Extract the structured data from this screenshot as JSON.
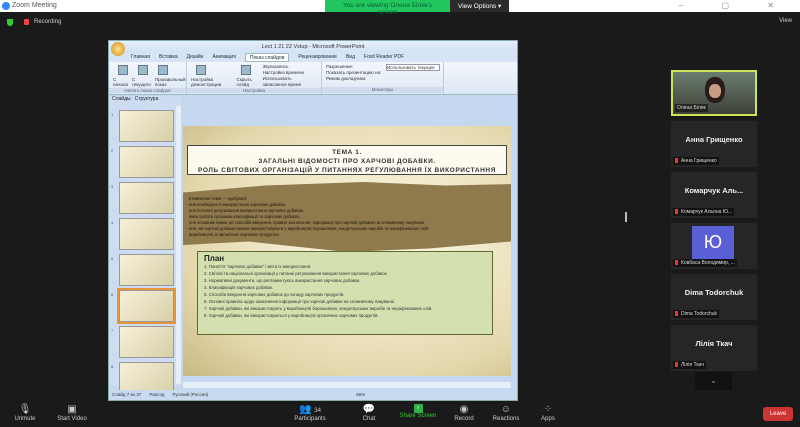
{
  "window": {
    "title": "Zoom Meeting",
    "banner": "You are viewing Олена Біляк's screen",
    "view_options": "View Options ▾",
    "controls": "– ▢ ✕"
  },
  "topbar": {
    "recording": "Recording",
    "view": "View"
  },
  "ppt": {
    "title": "Lect 1 21 22 Vstup - Microsoft PowerPoint",
    "tabs": [
      "Главная",
      "Вставка",
      "Дизайн",
      "Анимация",
      "Показ слайдов",
      "Рецензирование",
      "Вид",
      "Foxit Reader PDF"
    ],
    "groups": [
      {
        "label": "Начать показ слайдов",
        "buttons": [
          "С начала",
          "С текущего слайда",
          "Произвольный показ"
        ]
      },
      {
        "label": "Настройка",
        "buttons": [
          "Настройка демонстрации",
          "Скрыть слайд",
          "Звукозапись",
          "Настройка времени",
          "Использовать записанное время"
        ]
      },
      {
        "label": "Мониторы",
        "buttons": [
          "Разрешение:",
          "Показать презентацию на:",
          "Режим докладчика",
          "Использовать текущее"
        ]
      }
    ],
    "side_tabs": [
      "Слайды",
      "Структура"
    ],
    "slide_numbers": [
      "1",
      "2",
      "3",
      "4",
      "5",
      "6",
      "7",
      "8"
    ],
    "status": [
      "Слайд 7 из 37",
      "Рапсод",
      "Русский (Россия)",
      "55%"
    ]
  },
  "slide": {
    "title_lines": [
      "ТЕМА 1.",
      "ЗАГАЛЬНІ ВІДОМОСТІ ПРО ХАРЧОВІ ДОБАВКИ.",
      "РОЛЬ СВІТОВИХ ОРГАНІЗАЦІЙ У ПИТАННЯХ РЕГУЛЮВАННЯ ЇХ ВИКОРИСТАННЯ"
    ],
    "band_lines": [
      "в вивчення теми — здобувачі:",
      "ння необхідності використання харчових добавок,",
      "ння питання регулювання використання харчових добавок,",
      "ямок роботи органами класифікації та харчових добавок,",
      "ння основних вимог до способів введення, правил зазначення, інформації про харчові добавки на споживчому пакуванні,",
      "ння, які харчові добавки можна використовувати у виробництві борошняних, кондитерських виробів та нерафінованих олій",
      "виробництві, в органічних харчових продуктах"
    ],
    "plan_title": "План",
    "plan_items": [
      "1. Поняття \"харчової добавки\" і мета їх використання.",
      "2. Світові та національні організації у питанні регулювання використання харчових добавок.",
      "3. Нормативні документи, що регламентують використання харчових добавок.",
      "4. Класифікація харчових добавок.",
      "5. Способи введення харчових добавок до складу харчових продуктів.",
      "6. Основні правила щодо зазначення інформації про харчові добавки на споживчому пакуванні.",
      "7. Харчові добавки, які використовують у виробництві борошняних, кондитерських виробів та нерафінованих олій.",
      "8. Харчові добавки, які використовуються у виробництві органічних харчових продуктів."
    ]
  },
  "participants": [
    {
      "name": "Олена Біляк",
      "video": true
    },
    {
      "name": "Анна Грищенко",
      "label": "Анна Грищенко"
    },
    {
      "name": "Комарчук Аль...",
      "label": "Комарчук Альона Ю..."
    },
    {
      "name": "Ю",
      "label": "Ковбаса Володимир, ..."
    },
    {
      "name": "Dima Todorchuk",
      "label": "Dima Todorchuk"
    },
    {
      "name": "Лілія Ткач",
      "label": "Лілія Ткач"
    }
  ],
  "toolbar": {
    "unmute": "Unmute",
    "start_video": "Start Video",
    "participants": "Participants",
    "participants_count": "34",
    "chat": "Chat",
    "share": "Share Screen",
    "record": "Record",
    "reactions": "Reactions",
    "apps": "Apps",
    "leave": "Leave"
  }
}
